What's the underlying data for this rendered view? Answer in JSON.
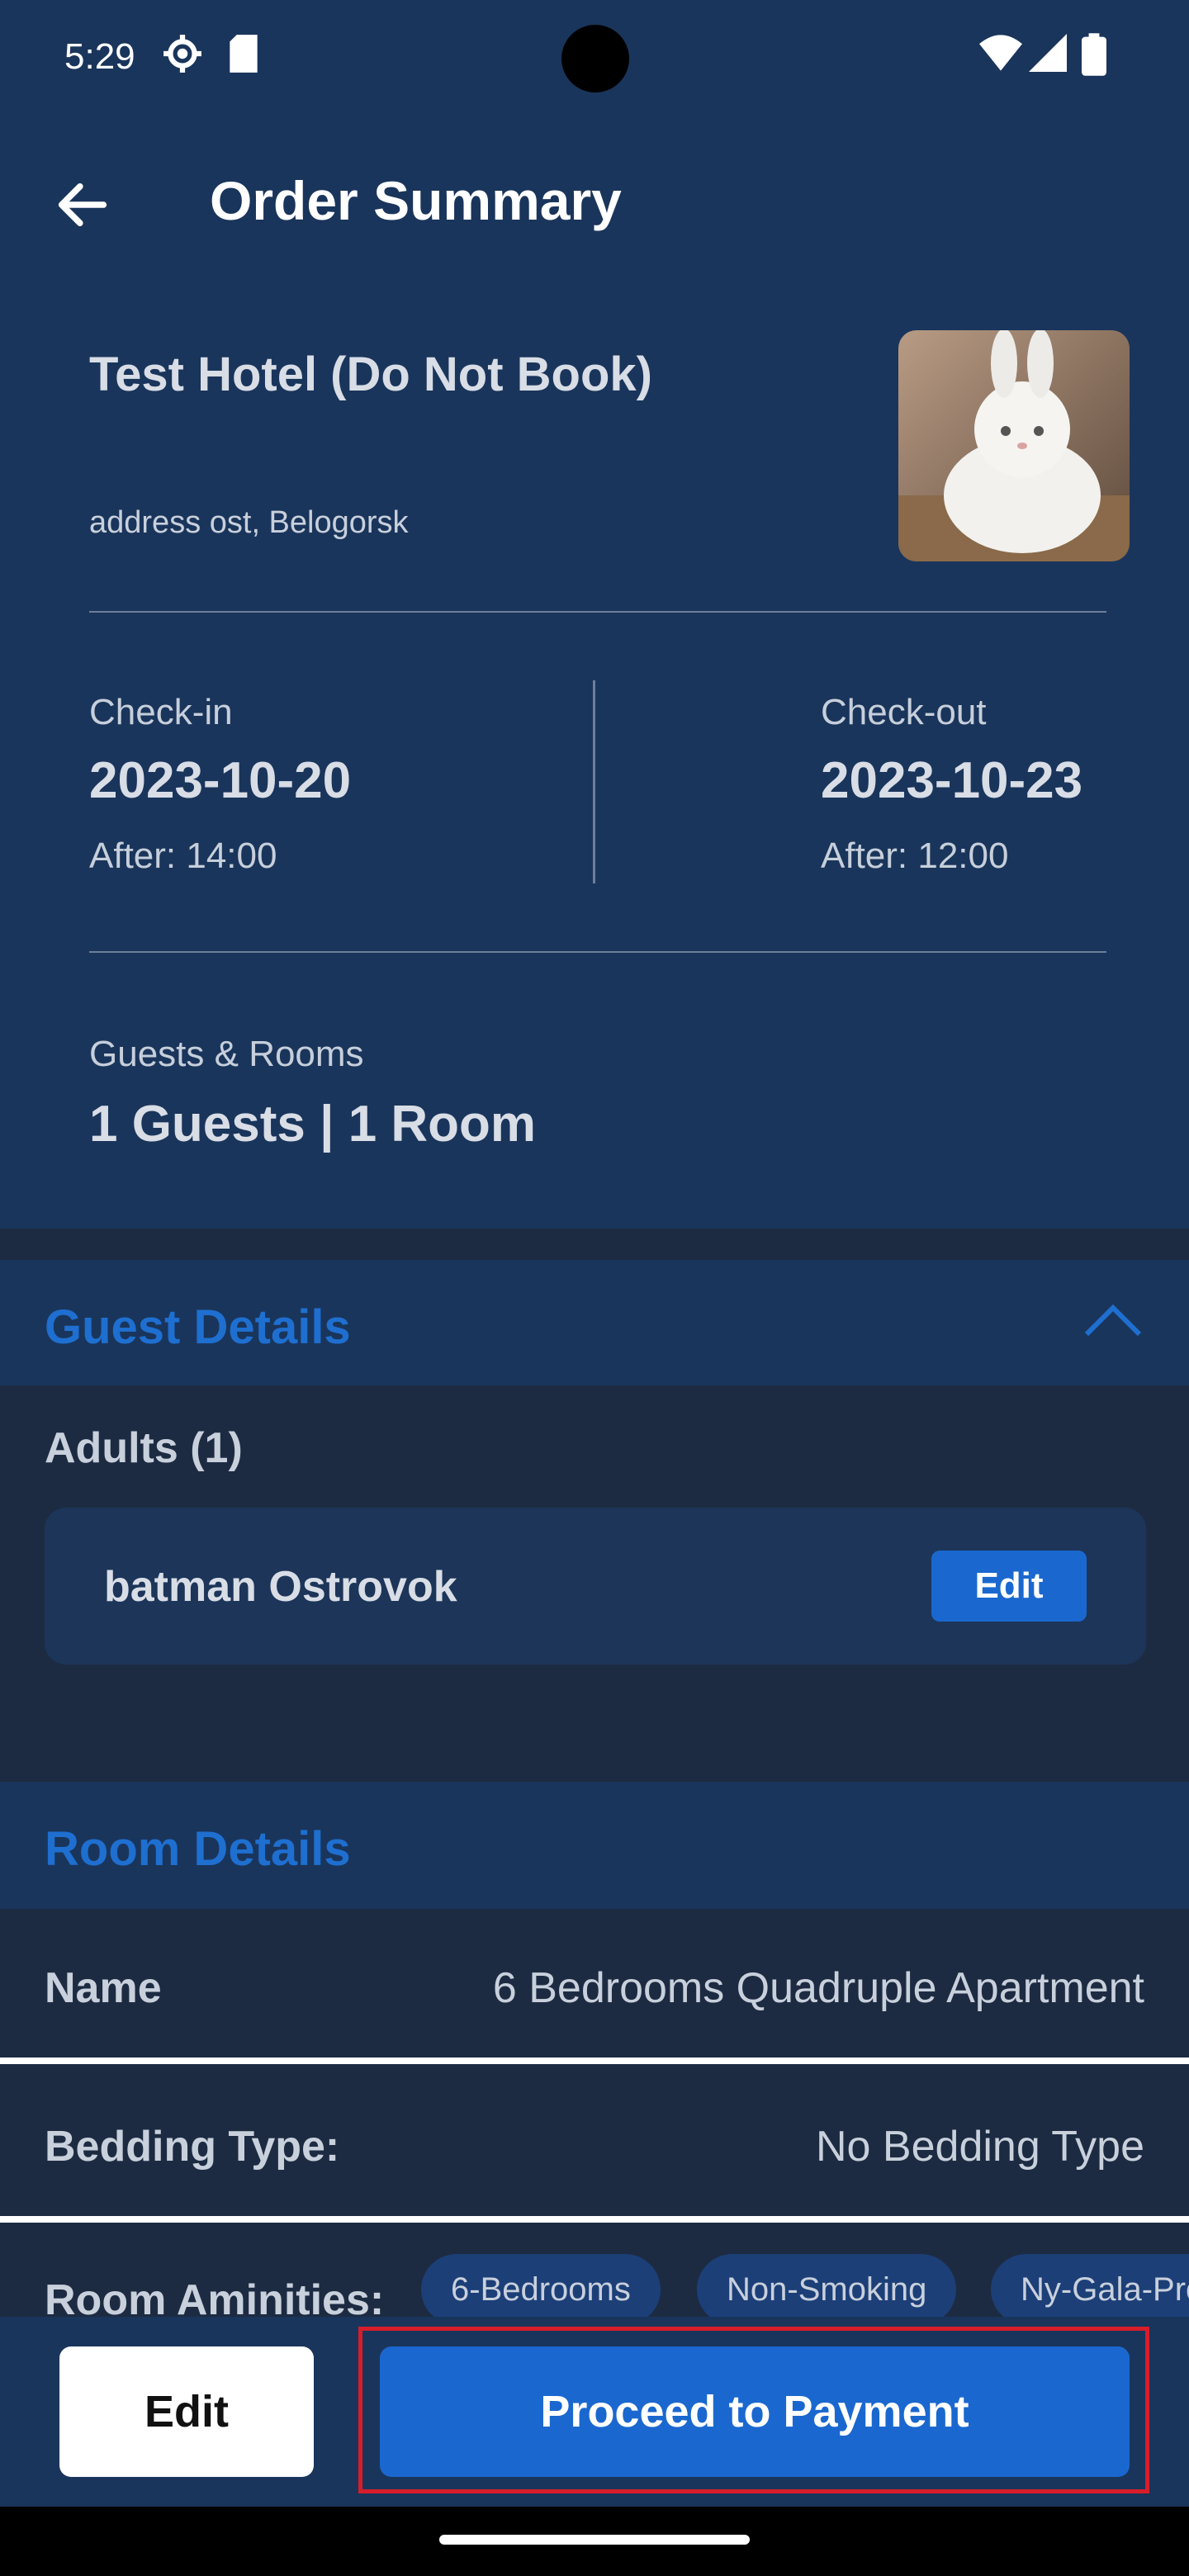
{
  "status_bar": {
    "time": "5:29"
  },
  "header": {
    "title": "Order Summary"
  },
  "hotel": {
    "name": "Test Hotel (Do Not Book)",
    "address": "address ost, Belogorsk",
    "photo": "cat-photo"
  },
  "stay": {
    "checkin_label": "Check-in",
    "checkin_date": "2023-10-20",
    "checkin_time": "After: 14:00",
    "checkout_label": "Check-out",
    "checkout_date": "2023-10-23",
    "checkout_time": "After: 12:00",
    "guests_label": "Guests & Rooms",
    "guests_value": "1 Guests | 1 Room"
  },
  "guest_details": {
    "title": "Guest Details",
    "adults_label": "Adults (1)",
    "guest_name": "batman Ostrovok",
    "edit_label": "Edit"
  },
  "room_details": {
    "title": "Room Details",
    "name_label": "Name",
    "name_value": "6 Bedrooms Quadruple Apartment",
    "bedding_label": "Bedding Type:",
    "bedding_value": "No Bedding Type",
    "amenities_label": "Room Aminities:",
    "amenities": [
      "6-Bedrooms",
      "Non-Smoking",
      "Ny-Gala-Pro"
    ]
  },
  "footer": {
    "edit_label": "Edit",
    "proceed_label": "Proceed to Payment"
  },
  "colors": {
    "primary": "#1a68cf",
    "header_bg": "#1a355b",
    "page_bg": "#1d2b42",
    "highlight": "#d81d2a"
  }
}
